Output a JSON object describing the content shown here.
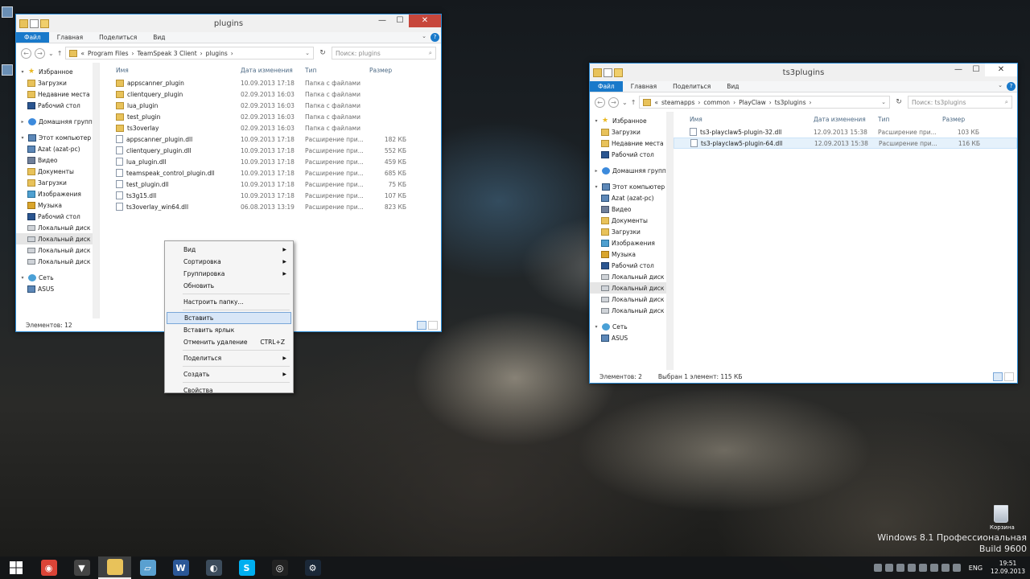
{
  "left_window": {
    "title": "plugins",
    "ribbon_tabs": [
      "Файл",
      "Главная",
      "Поделиться",
      "Вид"
    ],
    "address": [
      "«",
      "Program Files",
      "TeamSpeak 3 Client",
      "plugins"
    ],
    "search_placeholder": "Поиск: plugins",
    "nav": [
      {
        "label": "Избранное",
        "icon": "star",
        "level": 0,
        "tri": "▾"
      },
      {
        "label": "Загрузки",
        "icon": "fold",
        "level": 1
      },
      {
        "label": "Недавние места",
        "icon": "fold",
        "level": 1
      },
      {
        "label": "Рабочий стол",
        "icon": "dark",
        "level": 1
      },
      {
        "label": "",
        "icon": "",
        "level": 0,
        "spacer": true
      },
      {
        "label": "Домашняя группа",
        "icon": "grp",
        "level": 0,
        "tri": "▸"
      },
      {
        "label": "",
        "icon": "",
        "level": 0,
        "spacer": true
      },
      {
        "label": "Этот компьютер",
        "icon": "comp",
        "level": 0,
        "tri": "▾"
      },
      {
        "label": "Azat (azat-pc)",
        "icon": "comp",
        "level": 1
      },
      {
        "label": "Видео",
        "icon": "vid",
        "level": 1
      },
      {
        "label": "Документы",
        "icon": "doc",
        "level": 1
      },
      {
        "label": "Загрузки",
        "icon": "fold",
        "level": 1
      },
      {
        "label": "Изображения",
        "icon": "pic",
        "level": 1
      },
      {
        "label": "Музыка",
        "icon": "music",
        "level": 1
      },
      {
        "label": "Рабочий стол",
        "icon": "dark",
        "level": 1
      },
      {
        "label": "Локальный диск",
        "icon": "drive",
        "level": 1
      },
      {
        "label": "Локальный диск",
        "icon": "drive",
        "level": 1,
        "sel": true
      },
      {
        "label": "Локальный диск",
        "icon": "drive",
        "level": 1
      },
      {
        "label": "Локальный диск",
        "icon": "drive",
        "level": 1
      },
      {
        "label": "",
        "icon": "",
        "level": 0,
        "spacer": true
      },
      {
        "label": "Сеть",
        "icon": "net",
        "level": 0,
        "tri": "▾"
      },
      {
        "label": "ASUS",
        "icon": "comp",
        "level": 1
      }
    ],
    "columns": [
      "Имя",
      "Дата изменения",
      "Тип",
      "Размер"
    ],
    "files": [
      {
        "name": "appscanner_plugin",
        "date": "10.09.2013 17:18",
        "type": "Папка с файлами",
        "size": "",
        "kind": "folder"
      },
      {
        "name": "clientquery_plugin",
        "date": "02.09.2013 16:03",
        "type": "Папка с файлами",
        "size": "",
        "kind": "folder"
      },
      {
        "name": "lua_plugin",
        "date": "02.09.2013 16:03",
        "type": "Папка с файлами",
        "size": "",
        "kind": "folder"
      },
      {
        "name": "test_plugin",
        "date": "02.09.2013 16:03",
        "type": "Папка с файлами",
        "size": "",
        "kind": "folder"
      },
      {
        "name": "ts3overlay",
        "date": "02.09.2013 16:03",
        "type": "Папка с файлами",
        "size": "",
        "kind": "folder"
      },
      {
        "name": "appscanner_plugin.dll",
        "date": "10.09.2013 17:18",
        "type": "Расширение при...",
        "size": "182 КБ",
        "kind": "dll"
      },
      {
        "name": "clientquery_plugin.dll",
        "date": "10.09.2013 17:18",
        "type": "Расширение при...",
        "size": "552 КБ",
        "kind": "dll"
      },
      {
        "name": "lua_plugin.dll",
        "date": "10.09.2013 17:18",
        "type": "Расширение при...",
        "size": "459 КБ",
        "kind": "dll"
      },
      {
        "name": "teamspeak_control_plugin.dll",
        "date": "10.09.2013 17:18",
        "type": "Расширение при...",
        "size": "685 КБ",
        "kind": "dll"
      },
      {
        "name": "test_plugin.dll",
        "date": "10.09.2013 17:18",
        "type": "Расширение при...",
        "size": "75 КБ",
        "kind": "dll"
      },
      {
        "name": "ts3g15.dll",
        "date": "10.09.2013 17:18",
        "type": "Расширение при...",
        "size": "107 КБ",
        "kind": "dll"
      },
      {
        "name": "ts3overlay_win64.dll",
        "date": "06.08.2013 13:19",
        "type": "Расширение при...",
        "size": "823 КБ",
        "kind": "dll"
      }
    ],
    "status": "Элементов: 12"
  },
  "right_window": {
    "title": "ts3plugins",
    "ribbon_tabs": [
      "Файл",
      "Главная",
      "Поделиться",
      "Вид"
    ],
    "address": [
      "«",
      "steamapps",
      "common",
      "PlayClaw",
      "ts3plugins"
    ],
    "search_placeholder": "Поиск: ts3plugins",
    "nav": [
      {
        "label": "Избранное",
        "icon": "star",
        "level": 0,
        "tri": "▾"
      },
      {
        "label": "Загрузки",
        "icon": "fold",
        "level": 1
      },
      {
        "label": "Недавние места",
        "icon": "fold",
        "level": 1
      },
      {
        "label": "Рабочий стол",
        "icon": "dark",
        "level": 1
      },
      {
        "label": "",
        "icon": "",
        "level": 0,
        "spacer": true
      },
      {
        "label": "Домашняя группа",
        "icon": "grp",
        "level": 0,
        "tri": "▸"
      },
      {
        "label": "",
        "icon": "",
        "level": 0,
        "spacer": true
      },
      {
        "label": "Этот компьютер",
        "icon": "comp",
        "level": 0,
        "tri": "▾"
      },
      {
        "label": "Azat (azat-pc)",
        "icon": "comp",
        "level": 1
      },
      {
        "label": "Видео",
        "icon": "vid",
        "level": 1
      },
      {
        "label": "Документы",
        "icon": "doc",
        "level": 1
      },
      {
        "label": "Загрузки",
        "icon": "fold",
        "level": 1
      },
      {
        "label": "Изображения",
        "icon": "pic",
        "level": 1
      },
      {
        "label": "Музыка",
        "icon": "music",
        "level": 1
      },
      {
        "label": "Рабочий стол",
        "icon": "dark",
        "level": 1
      },
      {
        "label": "Локальный диск",
        "icon": "drive",
        "level": 1
      },
      {
        "label": "Локальный диск",
        "icon": "drive",
        "level": 1,
        "sel": true
      },
      {
        "label": "Локальный диск",
        "icon": "drive",
        "level": 1
      },
      {
        "label": "Локальный диск",
        "icon": "drive",
        "level": 1
      },
      {
        "label": "",
        "icon": "",
        "level": 0,
        "spacer": true
      },
      {
        "label": "Сеть",
        "icon": "net",
        "level": 0,
        "tri": "▾"
      },
      {
        "label": "ASUS",
        "icon": "comp",
        "level": 1
      }
    ],
    "columns": [
      "Имя",
      "Дата изменения",
      "Тип",
      "Размер"
    ],
    "files": [
      {
        "name": "ts3-playclaw5-plugin-32.dll",
        "date": "12.09.2013 15:38",
        "type": "Расширение при...",
        "size": "103 КБ",
        "kind": "dll"
      },
      {
        "name": "ts3-playclaw5-plugin-64.dll",
        "date": "12.09.2013 15:38",
        "type": "Расширение при...",
        "size": "116 КБ",
        "kind": "dll",
        "sel": true
      }
    ],
    "status": "Элементов: 2",
    "status_sel": "Выбран 1 элемент: 115 КБ"
  },
  "context_menu": [
    {
      "label": "Вид",
      "submenu": true
    },
    {
      "label": "Сортировка",
      "submenu": true
    },
    {
      "label": "Группировка",
      "submenu": true
    },
    {
      "label": "Обновить"
    },
    {
      "sep": true
    },
    {
      "label": "Настроить папку..."
    },
    {
      "sep": true
    },
    {
      "label": "Вставить",
      "highlight": true
    },
    {
      "label": "Вставить ярлык"
    },
    {
      "label": "Отменить удаление",
      "shortcut": "CTRL+Z"
    },
    {
      "sep": true
    },
    {
      "label": "Поделиться",
      "submenu": true
    },
    {
      "sep": true
    },
    {
      "label": "Создать",
      "submenu": true
    },
    {
      "sep": true
    },
    {
      "label": "Свойства"
    }
  ],
  "desktop": {
    "watermark_line1": "Windows 8.1 Профессиональная",
    "watermark_line2": "Build 9600",
    "recycle_label": "Корзина"
  },
  "taskbar": {
    "apps": [
      {
        "name": "chrome",
        "color": "#db4437",
        "glyph": "◉"
      },
      {
        "name": "shield",
        "color": "#444",
        "glyph": "▼"
      },
      {
        "name": "explorer",
        "color": "#e8c25a",
        "glyph": "",
        "active": true
      },
      {
        "name": "tablet",
        "color": "#5aa0d0",
        "glyph": "▱"
      },
      {
        "name": "word",
        "color": "#2b5797",
        "glyph": "W"
      },
      {
        "name": "teamspeak",
        "color": "#3c4c5c",
        "glyph": "◐"
      },
      {
        "name": "skype",
        "color": "#00aff0",
        "glyph": "S"
      },
      {
        "name": "obs",
        "color": "#222",
        "glyph": "◎"
      },
      {
        "name": "steam",
        "color": "#1b2838",
        "glyph": "⚙"
      }
    ],
    "lang": "ENG",
    "time": "19:51",
    "date": "12.09.2013"
  }
}
